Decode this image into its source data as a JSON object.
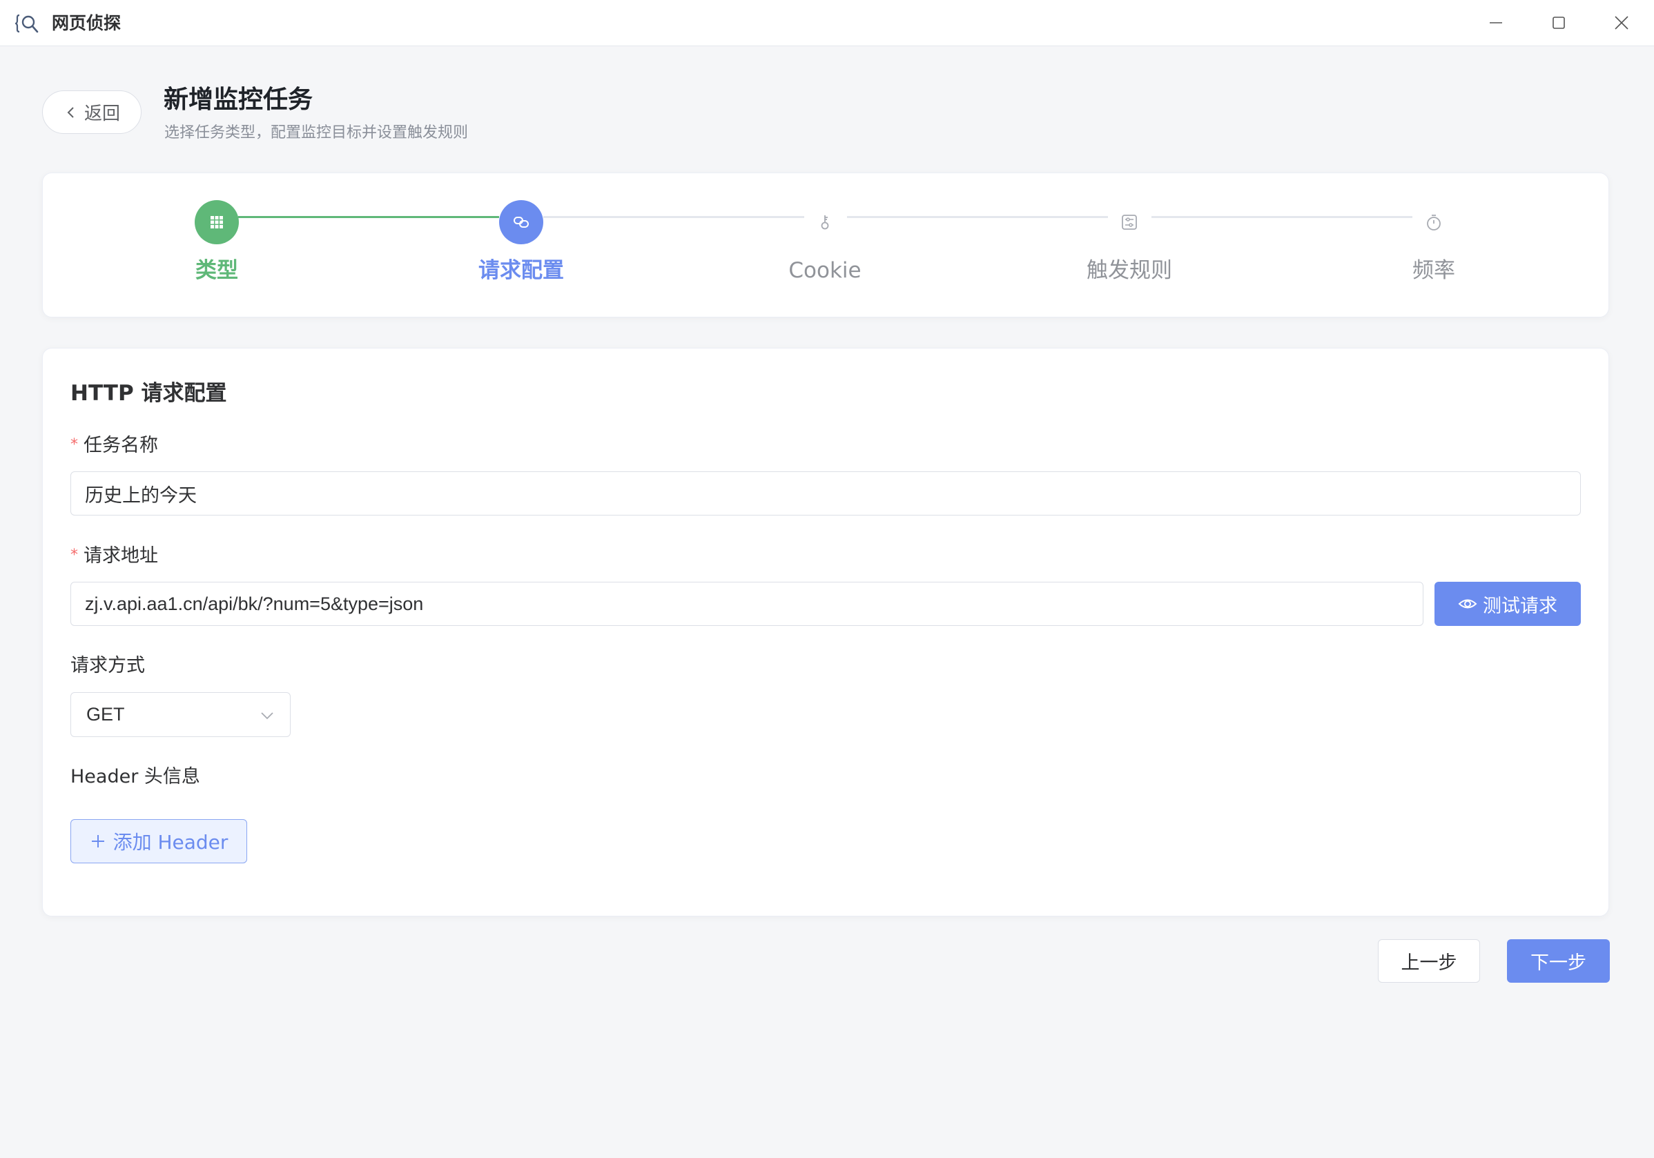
{
  "window": {
    "app_title": "网页侦探",
    "icon": "app-search-icon",
    "controls": [
      "minimize-icon",
      "maximize-icon",
      "close-icon"
    ]
  },
  "header": {
    "back_label": "返回",
    "title": "新增监控任务",
    "subtitle": "选择任务类型，配置监控目标并设置触发规则"
  },
  "steps": [
    {
      "label": "类型",
      "status": "done",
      "icon": "grid-icon"
    },
    {
      "label": "请求配置",
      "status": "active",
      "icon": "link-icon"
    },
    {
      "label": "Cookie",
      "status": "idle",
      "icon": "key-icon"
    },
    {
      "label": "触发规则",
      "status": "idle",
      "icon": "rules-icon"
    },
    {
      "label": "频率",
      "status": "idle",
      "icon": "timer-icon"
    }
  ],
  "form": {
    "section_title": "HTTP 请求配置",
    "task_name": {
      "label": "任务名称",
      "required_mark": "*",
      "value": "历史上的今天"
    },
    "url": {
      "label": "请求地址",
      "required_mark": "*",
      "value": "zj.v.api.aa1.cn/api/bk/?num=5&type=json",
      "test_label": "测试请求"
    },
    "method": {
      "label": "请求方式",
      "value": "GET"
    },
    "headers": {
      "label": "Header 头信息",
      "add_label": "添加 Header"
    }
  },
  "footer": {
    "prev_label": "上一步",
    "next_label": "下一步"
  },
  "colors": {
    "primary": "#6b8cef",
    "success": "#5fb878",
    "required": "#f56c6c",
    "background": "#f5f6f8"
  }
}
